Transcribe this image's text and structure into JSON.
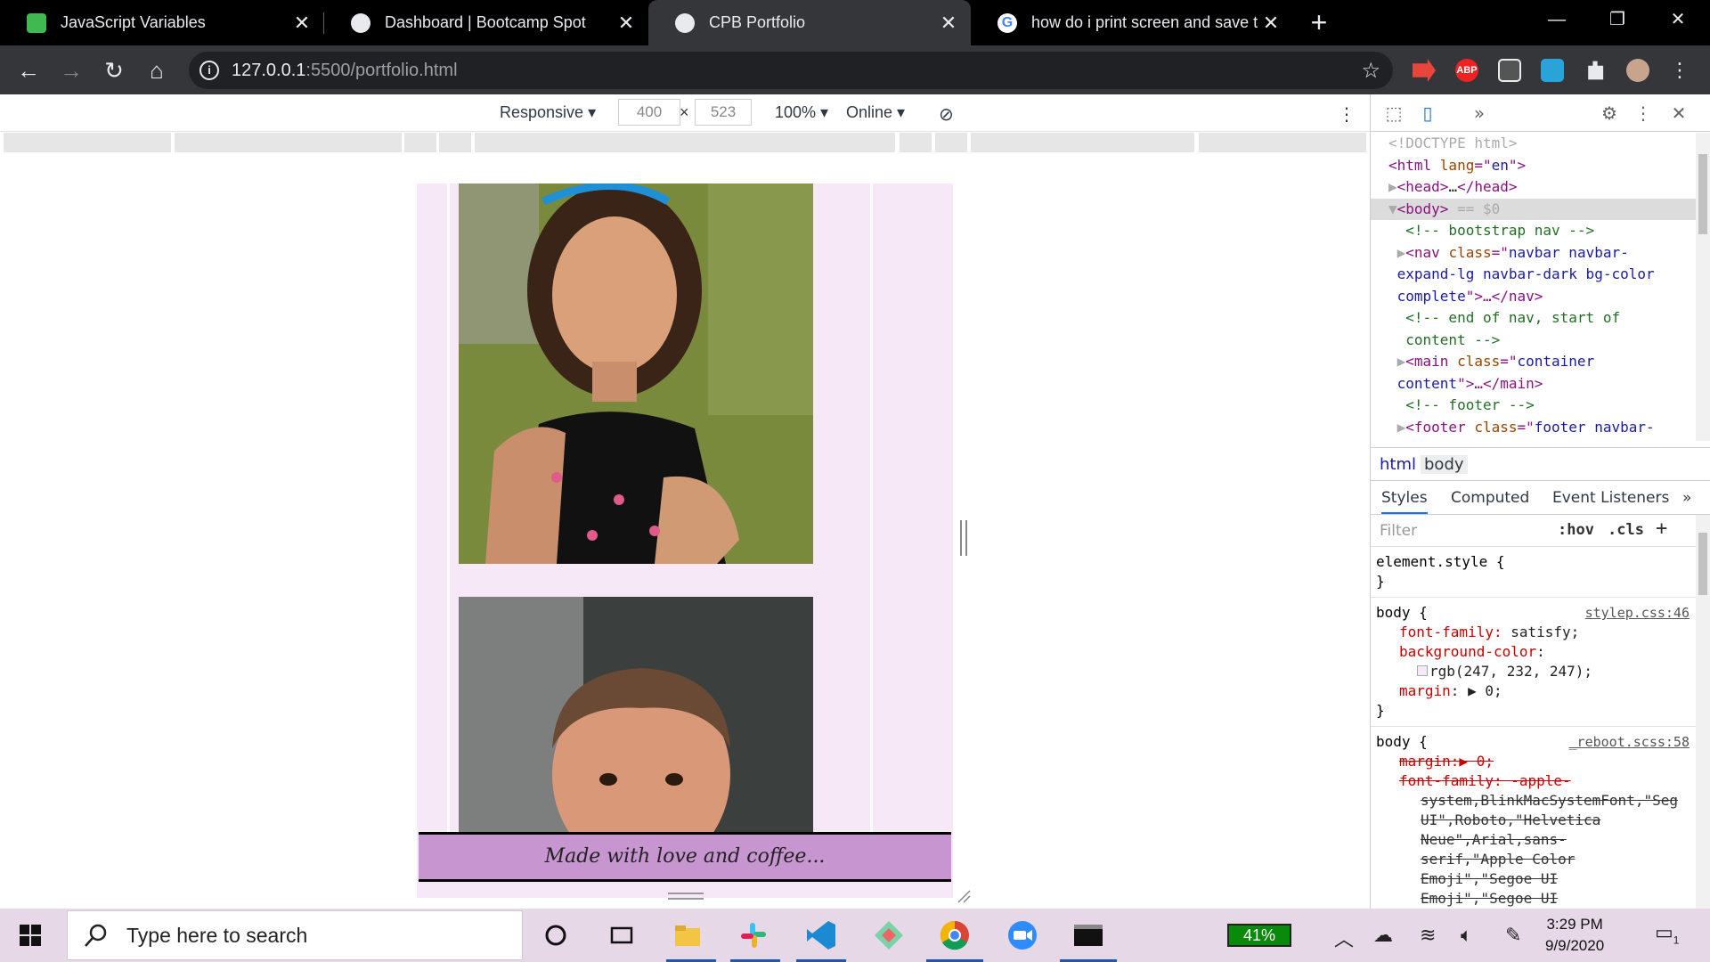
{
  "browser": {
    "tabs": [
      {
        "title": "JavaScript Variables",
        "favicon_color": "#3fb950",
        "active": false
      },
      {
        "title": "Dashboard | Bootcamp Spot",
        "favicon_color": "#e8eaed",
        "active": false
      },
      {
        "title": "CPB Portfolio",
        "favicon_color": "#e8eaed",
        "active": true
      },
      {
        "title": "how do i print screen and save to",
        "favicon_color": "#ffffff",
        "active": false
      }
    ],
    "url_host": "127.0.0.1",
    "url_rest": ":5500/portfolio.html",
    "extensions": [
      "video-extension",
      "adblock-plus",
      "bulb-extension",
      "cloud-extension",
      "puzzle-extensions",
      "profile-avatar"
    ],
    "ext_abp_label": "ABP"
  },
  "device_toolbar": {
    "mode": "Responsive",
    "width": "400",
    "x": "×",
    "height": "523",
    "zoom": "100%",
    "network": "Online"
  },
  "page": {
    "footer_text": "Made with love and coffee...",
    "bg_color": "#f7e8f7",
    "footer_color": "#c795d0"
  },
  "devtools": {
    "dom_lines": [
      {
        "parts": [
          {
            "t": "<!DOCTYPE html>",
            "c": "dim2"
          }
        ]
      },
      {
        "parts": [
          {
            "t": "<html ",
            "c": "tag"
          },
          {
            "t": "lang",
            "c": "attr"
          },
          {
            "t": "=\"",
            "c": "tag"
          },
          {
            "t": "en",
            "c": "val"
          },
          {
            "t": "\">",
            "c": "tag"
          }
        ]
      },
      {
        "parts": [
          {
            "t": "▶",
            "c": "dim2"
          },
          {
            "t": "<head>",
            "c": "tag"
          },
          {
            "t": "…",
            "c": "pval"
          },
          {
            "t": "</head>",
            "c": "tag"
          }
        ]
      },
      {
        "parts": [
          {
            "t": "▼",
            "c": "dim2"
          },
          {
            "t": "<body>",
            "c": "tag"
          },
          {
            "t": " == $0",
            "c": "dim2"
          }
        ]
      },
      {
        "parts": [
          {
            "t": "  <!-- bootstrap nav -->",
            "c": "cmt"
          }
        ]
      },
      {
        "parts": [
          {
            "t": " ▶",
            "c": "dim2"
          },
          {
            "t": "<nav ",
            "c": "tag"
          },
          {
            "t": "class",
            "c": "attr"
          },
          {
            "t": "=\"",
            "c": "tag"
          },
          {
            "t": "navbar navbar-",
            "c": "val"
          }
        ]
      },
      {
        "parts": [
          {
            "t": " expand-lg navbar-dark bg-color",
            "c": "val"
          }
        ]
      },
      {
        "parts": [
          {
            "t": " complete",
            "c": "val"
          },
          {
            "t": "\">…</nav>",
            "c": "tag"
          }
        ]
      },
      {
        "parts": [
          {
            "t": "  <!-- end of nav, start of",
            "c": "cmt"
          }
        ]
      },
      {
        "parts": [
          {
            "t": "  content -->",
            "c": "cmt"
          }
        ]
      },
      {
        "parts": [
          {
            "t": " ▶",
            "c": "dim2"
          },
          {
            "t": "<main ",
            "c": "tag"
          },
          {
            "t": "class",
            "c": "attr"
          },
          {
            "t": "=\"",
            "c": "tag"
          },
          {
            "t": "container",
            "c": "val"
          }
        ]
      },
      {
        "parts": [
          {
            "t": " content",
            "c": "val"
          },
          {
            "t": "\">…</main>",
            "c": "tag"
          }
        ]
      },
      {
        "parts": [
          {
            "t": "  <!-- footer -->",
            "c": "cmt"
          }
        ]
      },
      {
        "parts": [
          {
            "t": " ▶",
            "c": "dim2"
          },
          {
            "t": "<footer ",
            "c": "tag"
          },
          {
            "t": "class",
            "c": "attr"
          },
          {
            "t": "=\"",
            "c": "tag"
          },
          {
            "t": "footer navbar-",
            "c": "val"
          }
        ]
      }
    ],
    "breadcrumbs": [
      "html",
      "body"
    ],
    "panel_tabs": [
      "Styles",
      "Computed",
      "Event Listeners"
    ],
    "filter_placeholder": "Filter",
    "hov": ":hov",
    "cls": ".cls",
    "element_style": "element.style {",
    "close_brace": "}",
    "rule1": {
      "selector": "body {",
      "source": "stylep.css:46",
      "props": [
        {
          "name": "font-family",
          "value": " satisfy;"
        },
        {
          "name": "background-color",
          "value": ":"
        },
        {
          "name": "",
          "value": "rgb(247, 232, 247);"
        },
        {
          "name": "margin",
          "value": ": ▶ 0;"
        }
      ]
    },
    "rule2": {
      "selector": "body {",
      "source": "_reboot.scss:58",
      "lines": [
        "margin:▶ 0;",
        "font-family: -apple-",
        "system,BlinkMacSystemFont,\"Seg",
        "UI\",Roboto,\"Helvetica",
        "Neue\",Arial,sans-",
        "serif,\"Apple Color",
        "Emoji\",\"Segoe UI",
        "Emoji\",\"Segoe UI"
      ]
    }
  },
  "taskbar": {
    "search_placeholder": "Type here to search",
    "battery": "41%",
    "time": "3:29 PM",
    "date": "9/9/2020",
    "notifications": "1"
  }
}
